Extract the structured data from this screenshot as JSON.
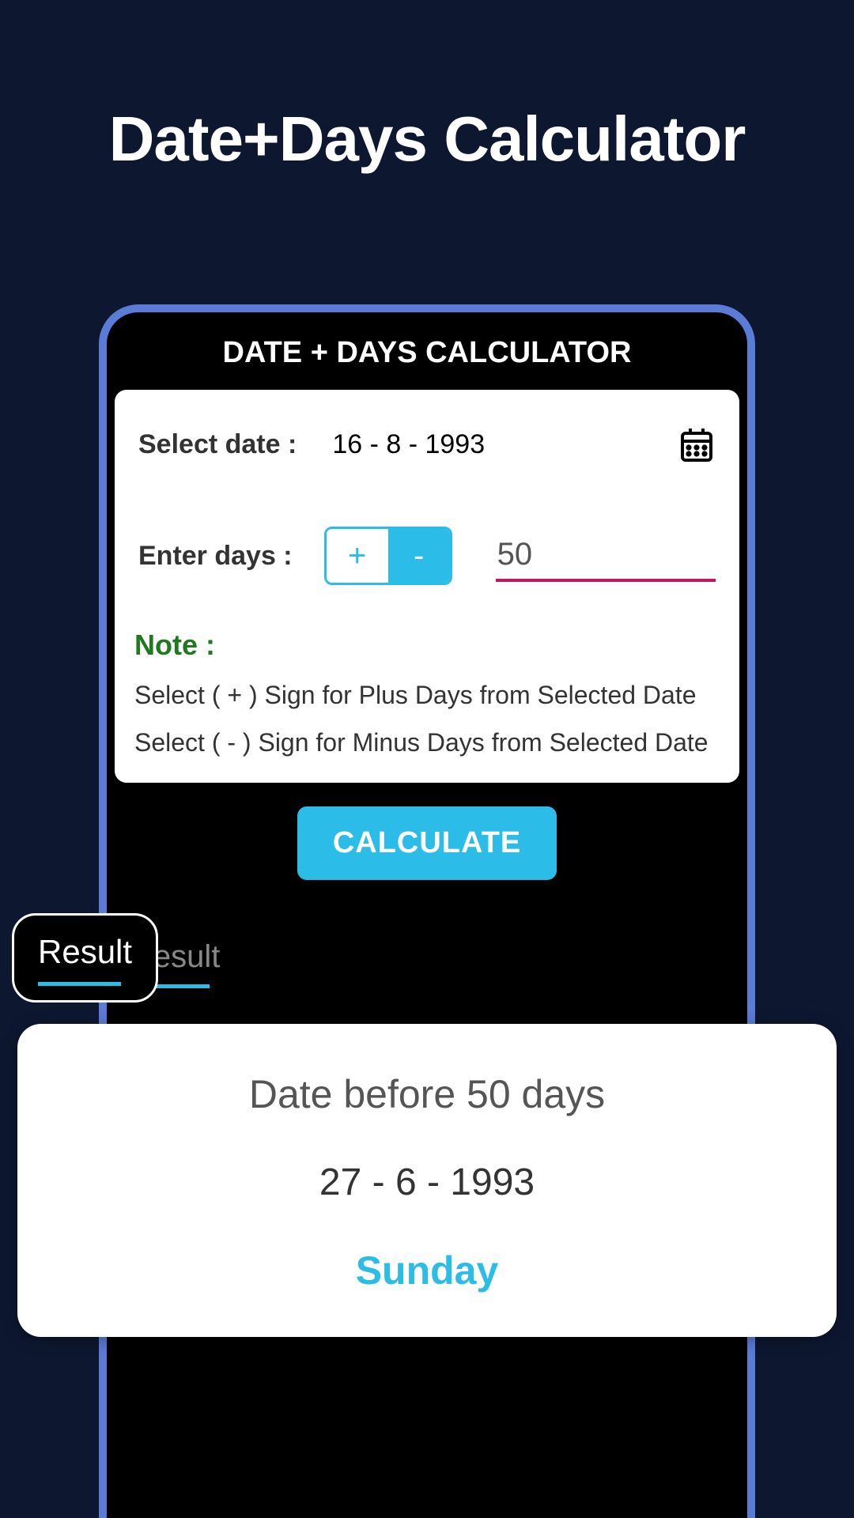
{
  "page_title": "Date+Days Calculator",
  "app_header": "DATE + DAYS CALCULATOR",
  "select_date_label": "Select date :",
  "selected_date": "16 - 8 - 1993",
  "enter_days_label": "Enter days :",
  "toggle_plus": "+",
  "toggle_minus": "-",
  "days_value": "50",
  "note_label": "Note :",
  "note_plus": "Select ( + ) Sign for Plus Days from Selected Date",
  "note_minus": "Select ( - ) Sign for Minus Days from Selected Date",
  "calculate_button": "CALCULATE",
  "result_label": "Result",
  "result": {
    "title": "Date before 50 days",
    "date": "27 - 6 - 1993",
    "day": "Sunday"
  }
}
